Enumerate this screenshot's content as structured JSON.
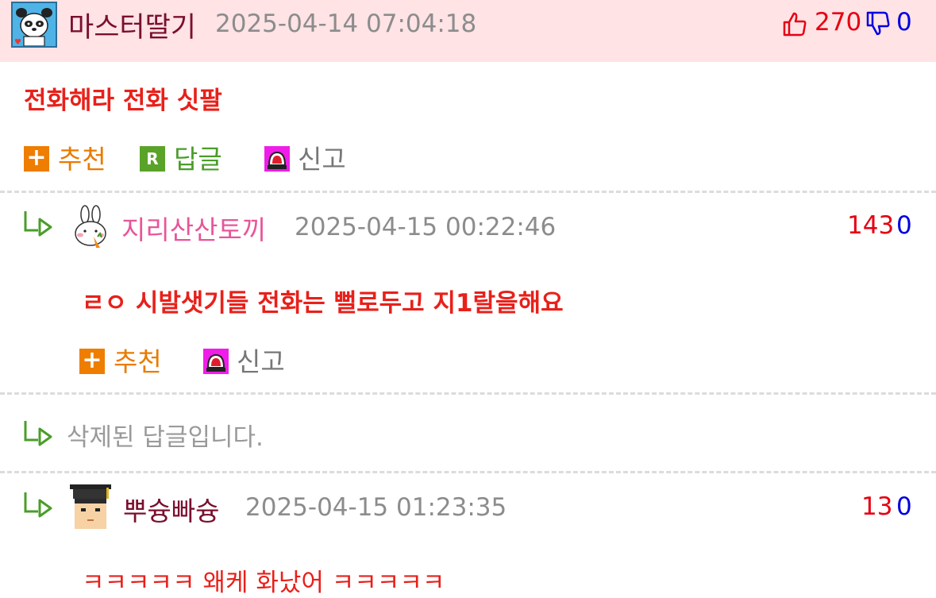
{
  "post": {
    "nickname": "마스터딸기",
    "date": "2025-04-14 07:04:18",
    "likes": "270",
    "dislikes": "0",
    "content": "전화해라 전화 싯팔",
    "actions": {
      "recommend": "추천",
      "reply": "답글",
      "report": "신고"
    }
  },
  "replies": [
    {
      "nickname": "지리산산토끼",
      "date": "2025-04-15 00:22:46",
      "likes": "143",
      "dislikes": "0",
      "content": "ㄹㅇ 시발샛기들 전화는 뻘로두고 지1랄을해요",
      "actions": {
        "recommend": "추천",
        "report": "신고"
      },
      "nickname_color": "#e8559a"
    },
    {
      "deleted_text": "삭제된 답글입니다."
    },
    {
      "nickname": "뿌슝빠슝",
      "date": "2025-04-15 01:23:35",
      "likes": "13",
      "dislikes": "0",
      "content": "ㅋㅋㅋㅋㅋ 왜케 화났어 ㅋㅋㅋㅋㅋ",
      "nickname_color": "#7a0f2e"
    }
  ],
  "colors": {
    "header_bg": "#ffe3e5",
    "like_red": "#e60012",
    "dislike_blue": "#0000e0",
    "content_red": "#e8201a",
    "action_orange": "#e97b00",
    "action_green": "#4a9d2a"
  },
  "icons": [
    "panda-avatar",
    "thumbs-up-icon",
    "thumbs-down-icon",
    "plus-icon",
    "reply-r-icon",
    "siren-icon",
    "reply-arrow-icon",
    "rabbit-avatar",
    "graduate-avatar"
  ]
}
